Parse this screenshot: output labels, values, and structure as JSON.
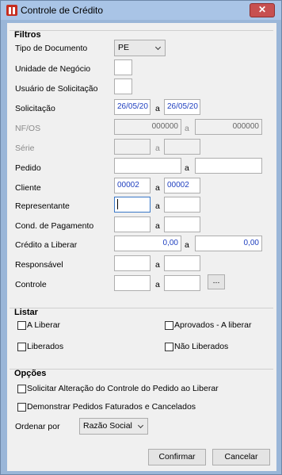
{
  "window": {
    "title": "Controle de Crédito",
    "close_label": "✕"
  },
  "filtros": {
    "title": "Filtros",
    "tipo_documento": {
      "label": "Tipo de Documento",
      "value": "PE"
    },
    "unidade_negocio": {
      "label": "Unidade de Negócio",
      "value": ""
    },
    "usuario_solicitacao": {
      "label": "Usuário de Solicitação",
      "value": ""
    },
    "solicitacao": {
      "label": "Solicitação",
      "from": "26/05/20",
      "to": "26/05/20"
    },
    "nf_os": {
      "label": "NF/OS",
      "from": "000000",
      "to": "000000"
    },
    "serie": {
      "label": "Série",
      "from": "",
      "to": ""
    },
    "pedido": {
      "label": "Pedido",
      "from": "",
      "to": ""
    },
    "cliente": {
      "label": "Cliente",
      "from": "00002",
      "to": "00002"
    },
    "representante": {
      "label": "Representante",
      "from": "",
      "to": ""
    },
    "cond_pagamento": {
      "label": "Cond. de Pagamento",
      "from": "",
      "to": ""
    },
    "credito_liberar": {
      "label": "Crédito a Liberar",
      "from": "0,00",
      "to": "0,00"
    },
    "responsavel": {
      "label": "Responsável",
      "from": "",
      "to": ""
    },
    "controle": {
      "label": "Controle",
      "from": "",
      "to": "",
      "browse": "..."
    },
    "range_separator": "a"
  },
  "listar": {
    "title": "Listar",
    "a_liberar": "A Liberar",
    "aprovados_a_liberar": "Aprovados - A liberar",
    "liberados": "Liberados",
    "nao_liberados": "Não Liberados"
  },
  "opcoes": {
    "title": "Opções",
    "solicitar_alteracao": "Solicitar Alteração do Controle do Pedido ao Liberar",
    "demonstrar_pedidos": "Demonstrar Pedidos Faturados e Cancelados",
    "ordenar_por": {
      "label": "Ordenar por",
      "value": "Razão Social"
    }
  },
  "buttons": {
    "confirmar": "Confirmar",
    "cancelar": "Cancelar"
  }
}
